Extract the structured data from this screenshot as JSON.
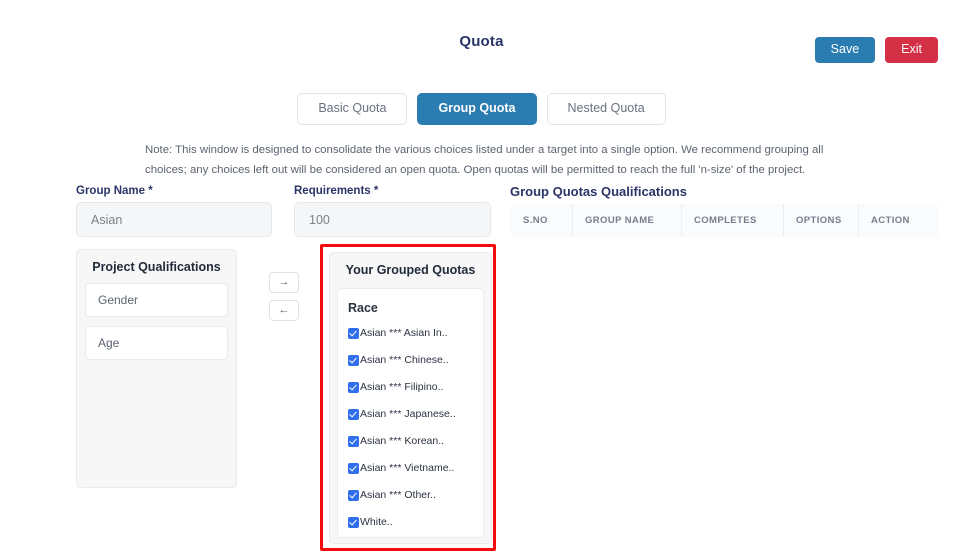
{
  "header": {
    "title": "Quota",
    "save_label": "Save",
    "exit_label": "Exit",
    "save_color": "#2b7cb0",
    "exit_color": "#d32f45"
  },
  "tabs": [
    {
      "label": "Basic Quota",
      "active": false
    },
    {
      "label": "Group Quota",
      "active": true
    },
    {
      "label": "Nested Quota",
      "active": false
    }
  ],
  "note": "Note: This window is designed to consolidate the various choices listed under a target into a single option. We recommend grouping all choices; any choices left out will be considered an open quota. Open quotas will be permitted to reach the full 'n-size' of the project.",
  "form": {
    "group_name_label": "Group Name *",
    "group_name_value": "Asian",
    "requirements_label": "Requirements *",
    "requirements_value": "100"
  },
  "qualifications_table": {
    "title": "Group Quotas Qualifications",
    "columns": [
      "S.NO",
      "GROUP NAME",
      "COMPLETES",
      "OPTIONS",
      "ACTION"
    ],
    "rows": []
  },
  "project_qualifications": {
    "heading": "Project Qualifications",
    "items": [
      {
        "label": "Gender"
      },
      {
        "label": "Age"
      }
    ]
  },
  "transfer_arrows": {
    "move_right": "→",
    "move_left": "←"
  },
  "grouped_quotas": {
    "heading": "Your Grouped Quotas",
    "group_label": "Race",
    "checkbox_color": "#2f6fed",
    "items": [
      {
        "label": "Asian *** Asian In..",
        "checked": true
      },
      {
        "label": "Asian *** Chinese..",
        "checked": true
      },
      {
        "label": "Asian *** Filipino..",
        "checked": true
      },
      {
        "label": "Asian *** Japanese..",
        "checked": true
      },
      {
        "label": "Asian *** Korean..",
        "checked": true
      },
      {
        "label": "Asian *** Vietname..",
        "checked": true
      },
      {
        "label": "Asian *** Other..",
        "checked": true
      },
      {
        "label": "White..",
        "checked": true
      }
    ]
  },
  "annotation": {
    "highlight_color": "#f40b0b"
  }
}
